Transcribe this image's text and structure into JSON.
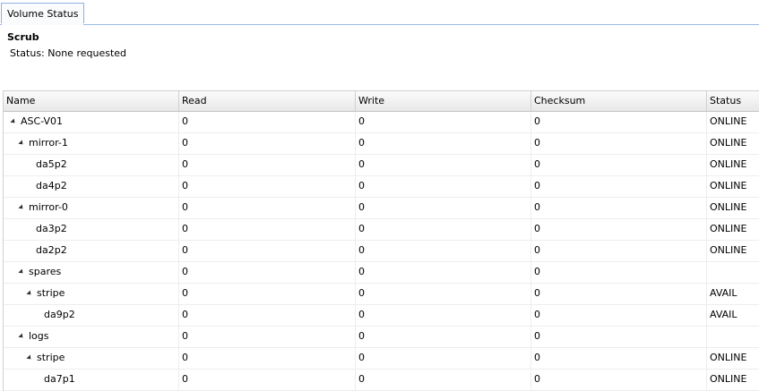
{
  "tab": {
    "label": "Volume Status"
  },
  "scrub": {
    "title": "Scrub",
    "status": "Status: None requested"
  },
  "columns": [
    "Name",
    "Read",
    "Write",
    "Checksum",
    "Status"
  ],
  "rows": [
    {
      "name": "ASC-V01",
      "level": 0,
      "expander": true,
      "read": "0",
      "write": "0",
      "checksum": "0",
      "status": "ONLINE"
    },
    {
      "name": "mirror-1",
      "level": 1,
      "expander": true,
      "read": "0",
      "write": "0",
      "checksum": "0",
      "status": "ONLINE"
    },
    {
      "name": "da5p2",
      "level": 2,
      "expander": false,
      "read": "0",
      "write": "0",
      "checksum": "0",
      "status": "ONLINE"
    },
    {
      "name": "da4p2",
      "level": 2,
      "expander": false,
      "read": "0",
      "write": "0",
      "checksum": "0",
      "status": "ONLINE"
    },
    {
      "name": "mirror-0",
      "level": 1,
      "expander": true,
      "read": "0",
      "write": "0",
      "checksum": "0",
      "status": "ONLINE"
    },
    {
      "name": "da3p2",
      "level": 2,
      "expander": false,
      "read": "0",
      "write": "0",
      "checksum": "0",
      "status": "ONLINE"
    },
    {
      "name": "da2p2",
      "level": 2,
      "expander": false,
      "read": "0",
      "write": "0",
      "checksum": "0",
      "status": "ONLINE"
    },
    {
      "name": "spares",
      "level": 1,
      "expander": true,
      "read": "0",
      "write": "0",
      "checksum": "0",
      "status": ""
    },
    {
      "name": "stripe",
      "level": 2,
      "expander": true,
      "read": "0",
      "write": "0",
      "checksum": "0",
      "status": "AVAIL"
    },
    {
      "name": "da9p2",
      "level": 3,
      "expander": false,
      "read": "0",
      "write": "0",
      "checksum": "0",
      "status": "AVAIL"
    },
    {
      "name": "logs",
      "level": 1,
      "expander": true,
      "read": "0",
      "write": "0",
      "checksum": "0",
      "status": ""
    },
    {
      "name": "stripe",
      "level": 2,
      "expander": true,
      "read": "0",
      "write": "0",
      "checksum": "0",
      "status": "ONLINE"
    },
    {
      "name": "da7p1",
      "level": 3,
      "expander": false,
      "read": "0",
      "write": "0",
      "checksum": "0",
      "status": "ONLINE"
    }
  ]
}
